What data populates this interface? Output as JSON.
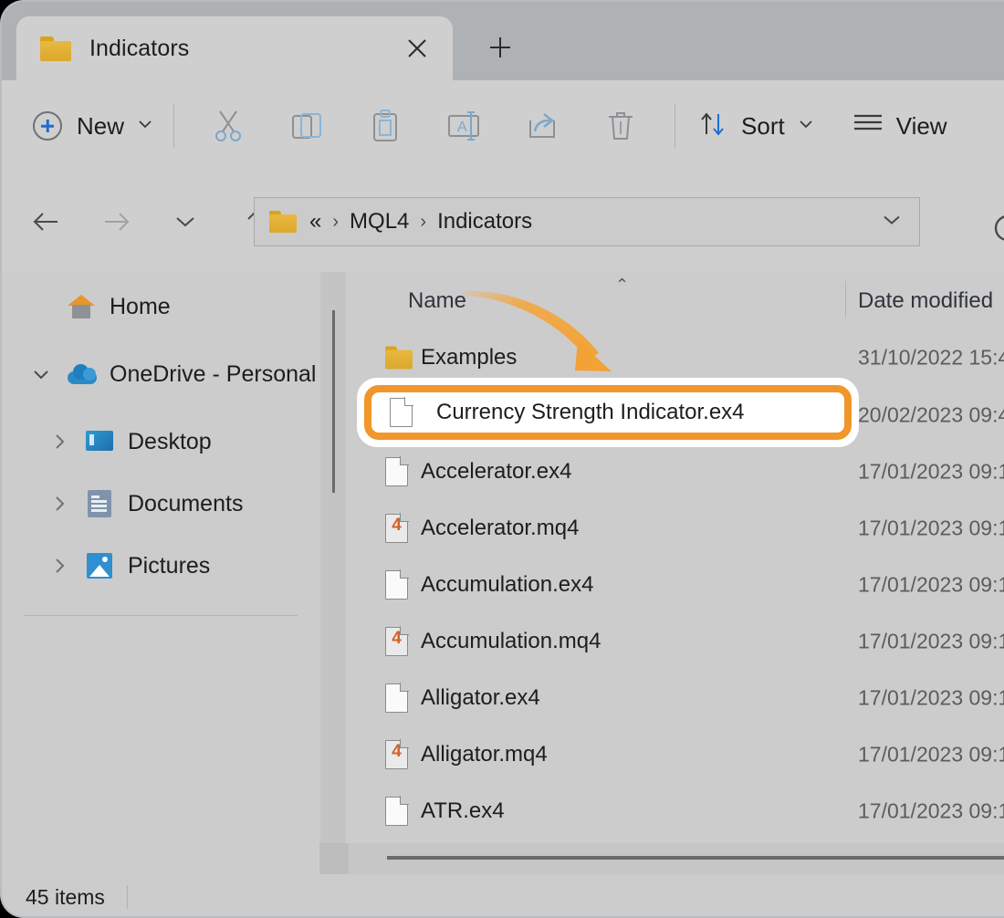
{
  "window": {
    "titlebar": {
      "tab": {
        "label": "Indicators",
        "icon": "folder-icon"
      },
      "close_label": "✕",
      "new_tab_label": "+"
    },
    "toolbar": {
      "new_button": {
        "label": "New",
        "icon": "plus-circle-icon",
        "caret": "⌄"
      },
      "items": [
        {
          "name": "cut",
          "icon": "scissors-icon"
        },
        {
          "name": "copy",
          "icon": "copy-icon"
        },
        {
          "name": "paste",
          "icon": "paste-icon"
        },
        {
          "name": "rename",
          "icon": "rename-icon"
        },
        {
          "name": "share",
          "icon": "share-icon"
        },
        {
          "name": "delete",
          "icon": "trash-icon"
        }
      ],
      "sort": {
        "label": "Sort",
        "icon": "sort-arrows-icon",
        "caret": "⌄"
      },
      "view": {
        "label": "View",
        "icon": "view-lines-icon"
      }
    },
    "addressbar": {
      "back_icon": "arrow-left-icon",
      "forward_icon": "arrow-right-icon",
      "recent_icon": "chevron-down-icon",
      "up_icon": "arrow-up-icon",
      "folder_icon": "folder-icon",
      "crumbs": [
        "«",
        "MQL4",
        "Indicators"
      ],
      "separator": "›",
      "dropdown_caret": "⌄",
      "search_icon": "search-icon"
    }
  },
  "sidebar": {
    "items": [
      {
        "label": "Home",
        "icon": "home-icon",
        "expander": "",
        "indent": false
      },
      {
        "label": "OneDrive - Personal",
        "icon": "onedrive-cloud-icon",
        "expander": "⌄",
        "indent": false
      },
      {
        "label": "Desktop",
        "icon": "desktop-icon",
        "expander": "›",
        "indent": true
      },
      {
        "label": "Documents",
        "icon": "documents-icon",
        "expander": "›",
        "indent": true
      },
      {
        "label": "Pictures",
        "icon": "pictures-icon",
        "expander": "›",
        "indent": true
      }
    ]
  },
  "filelist": {
    "columns": {
      "name": "Name",
      "date_modified": "Date modified"
    },
    "sort_caret": "⌃",
    "rows": [
      {
        "name": "Examples",
        "date": "31/10/2022 15:4",
        "icon": "folder-icon"
      },
      {
        "name": "Currency Strength Indicator.ex4",
        "date": "20/02/2023 09:4",
        "icon": "file-icon"
      },
      {
        "name": "Accelerator.ex4",
        "date": "17/01/2023 09:1",
        "icon": "file-icon"
      },
      {
        "name": "Accelerator.mq4",
        "date": "17/01/2023 09:1",
        "icon": "mq4-file-icon"
      },
      {
        "name": "Accumulation.ex4",
        "date": "17/01/2023 09:1",
        "icon": "file-icon"
      },
      {
        "name": "Accumulation.mq4",
        "date": "17/01/2023 09:1",
        "icon": "mq4-file-icon"
      },
      {
        "name": "Alligator.ex4",
        "date": "17/01/2023 09:1",
        "icon": "file-icon"
      },
      {
        "name": "Alligator.mq4",
        "date": "17/01/2023 09:1",
        "icon": "mq4-file-icon"
      },
      {
        "name": "ATR.ex4",
        "date": "17/01/2023 09:1",
        "icon": "file-icon"
      }
    ]
  },
  "annotation": {
    "highlighted_row_label": "Currency Strength Indicator.ex4",
    "highlight_color": "#f0962a",
    "arrow_color": "#f5a53c"
  },
  "statusbar": {
    "item_count": "45 items"
  }
}
